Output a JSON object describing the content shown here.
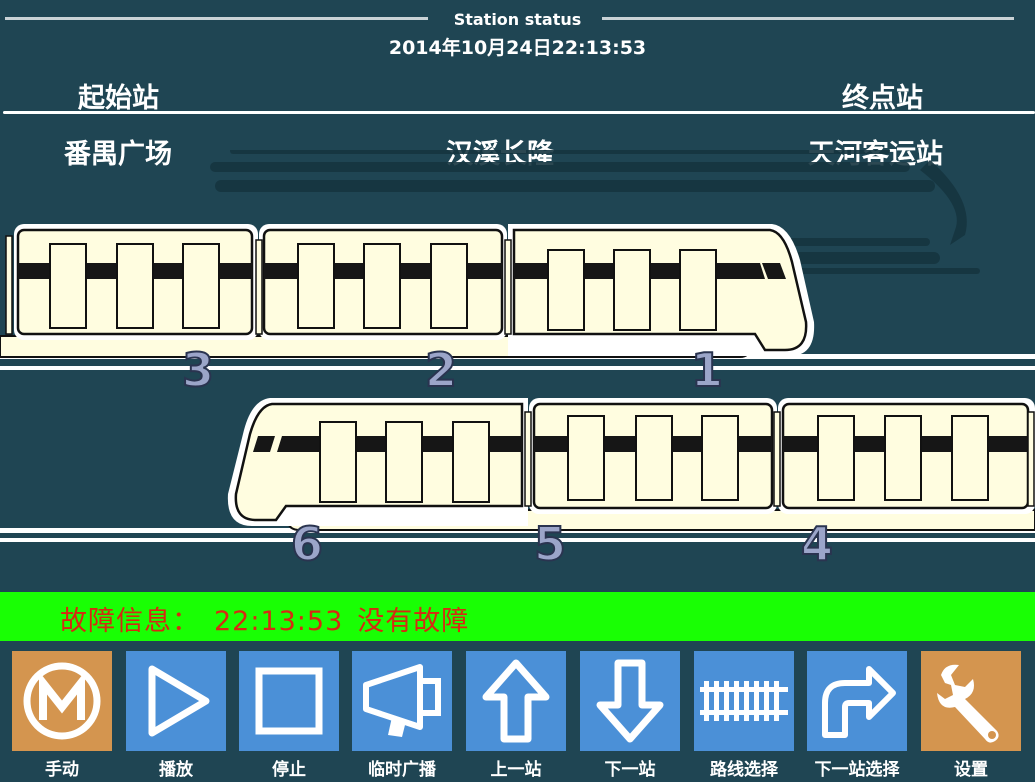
{
  "header": {
    "title": "Station status",
    "datetime": "2014年10月24日22:13:53"
  },
  "route": {
    "start_label": "起始站",
    "end_label": "终点站",
    "start_station": "番禺广场",
    "middle_station": "汉溪长隆",
    "end_station": "天河客运站"
  },
  "train": {
    "upper_cars": [
      "3",
      "2",
      "1"
    ],
    "lower_cars": [
      "6",
      "5",
      "4"
    ]
  },
  "fault": {
    "label": "故障信息：",
    "time": "22:13:53",
    "message": "没有故障"
  },
  "toolbar": {
    "buttons": [
      {
        "label": "手动",
        "icon": "metro-logo-icon",
        "color": "#d4954f"
      },
      {
        "label": "播放",
        "icon": "play-icon",
        "color": "#4b90d7"
      },
      {
        "label": "停止",
        "icon": "stop-icon",
        "color": "#4b90d7"
      },
      {
        "label": "临时广播",
        "icon": "megaphone-icon",
        "color": "#4b90d7"
      },
      {
        "label": "上一站",
        "icon": "arrow-up-icon",
        "color": "#4b90d7"
      },
      {
        "label": "下一站",
        "icon": "arrow-down-icon",
        "color": "#4b90d7"
      },
      {
        "label": "路线选择",
        "icon": "railway-track-icon",
        "color": "#4b90d7"
      },
      {
        "label": "下一站选择",
        "icon": "turn-right-arrow-icon",
        "color": "#4b90d7"
      },
      {
        "label": "设置",
        "icon": "wrench-icon",
        "color": "#d4954f"
      }
    ]
  },
  "colors": {
    "background": "#1f4553",
    "train_body": "#fffde0",
    "status_bar": "#19ff04",
    "status_text": "#d62a12"
  }
}
